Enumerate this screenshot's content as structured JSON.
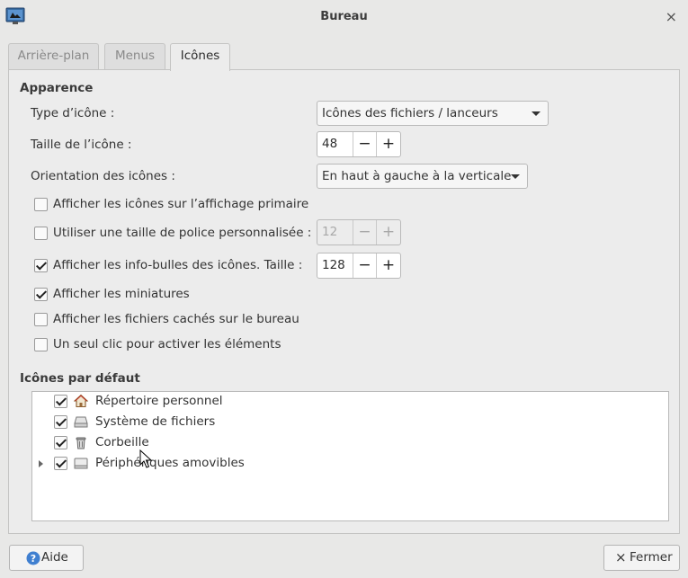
{
  "window": {
    "title": "Bureau"
  },
  "tabs": [
    {
      "label": "Arrière-plan",
      "active": false
    },
    {
      "label": "Menus",
      "active": false
    },
    {
      "label": "Icônes",
      "active": true
    }
  ],
  "appearance": {
    "title": "Apparence",
    "icon_type": {
      "label": "Type d’icône :",
      "value": "Icônes des fichiers / lanceurs"
    },
    "icon_size": {
      "label": "Taille de l’icône :",
      "value": "48"
    },
    "orientation": {
      "label": "Orientation des icônes :",
      "value": "En haut à gauche à la verticale"
    },
    "options": [
      {
        "label": "Afficher les icônes sur l’affichage primaire",
        "checked": false
      },
      {
        "label": "Utiliser une taille de police personnalisée :",
        "checked": false,
        "spin_value": "12",
        "spin_enabled": false
      },
      {
        "label": "Afficher les info-bulles des icônes. Taille :",
        "checked": true,
        "spin_value": "128",
        "spin_enabled": true
      },
      {
        "label": "Afficher les miniatures",
        "checked": true
      },
      {
        "label": "Afficher les fichiers cachés sur le bureau",
        "checked": false
      },
      {
        "label": "Un seul clic pour activer les éléments",
        "checked": false
      }
    ],
    "spin_minus": "−",
    "spin_plus": "+"
  },
  "default_icons": {
    "title": "Icônes par défaut",
    "items": [
      {
        "label": "Répertoire personnel",
        "checked": true,
        "icon": "home-icon"
      },
      {
        "label": "Système de fichiers",
        "checked": true,
        "icon": "drive-icon"
      },
      {
        "label": "Corbeille",
        "checked": true,
        "icon": "trash-icon"
      },
      {
        "label": "Périphériques amovibles",
        "checked": true,
        "icon": "removable-drive-icon",
        "expandable": true
      }
    ]
  },
  "buttons": {
    "help": "Aide",
    "close": "Fermer",
    "close_glyph": "×"
  },
  "colors": {
    "accent_help": "#3f7fd0",
    "window_bg": "#e8e8e7"
  }
}
